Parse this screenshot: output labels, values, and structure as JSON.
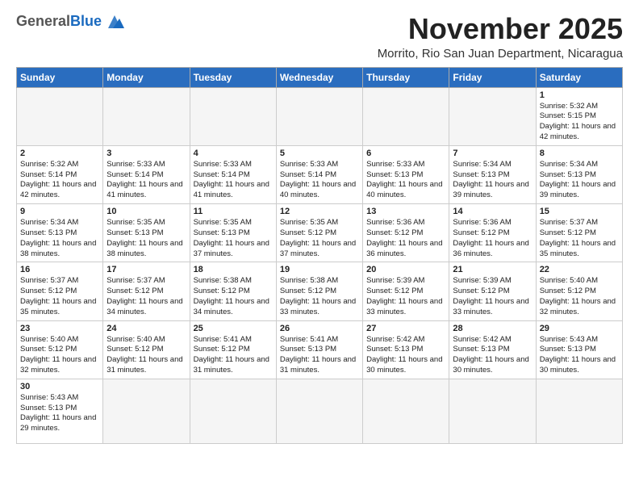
{
  "header": {
    "logo_general": "General",
    "logo_blue": "Blue",
    "month_title": "November 2025",
    "subtitle": "Morrito, Rio San Juan Department, Nicaragua"
  },
  "weekdays": [
    "Sunday",
    "Monday",
    "Tuesday",
    "Wednesday",
    "Thursday",
    "Friday",
    "Saturday"
  ],
  "weeks": [
    [
      {
        "day": "",
        "info": ""
      },
      {
        "day": "",
        "info": ""
      },
      {
        "day": "",
        "info": ""
      },
      {
        "day": "",
        "info": ""
      },
      {
        "day": "",
        "info": ""
      },
      {
        "day": "",
        "info": ""
      },
      {
        "day": "1",
        "info": "Sunrise: 5:32 AM\nSunset: 5:15 PM\nDaylight: 11 hours and 42 minutes."
      }
    ],
    [
      {
        "day": "2",
        "info": "Sunrise: 5:32 AM\nSunset: 5:14 PM\nDaylight: 11 hours and 42 minutes."
      },
      {
        "day": "3",
        "info": "Sunrise: 5:33 AM\nSunset: 5:14 PM\nDaylight: 11 hours and 41 minutes."
      },
      {
        "day": "4",
        "info": "Sunrise: 5:33 AM\nSunset: 5:14 PM\nDaylight: 11 hours and 41 minutes."
      },
      {
        "day": "5",
        "info": "Sunrise: 5:33 AM\nSunset: 5:14 PM\nDaylight: 11 hours and 40 minutes."
      },
      {
        "day": "6",
        "info": "Sunrise: 5:33 AM\nSunset: 5:13 PM\nDaylight: 11 hours and 40 minutes."
      },
      {
        "day": "7",
        "info": "Sunrise: 5:34 AM\nSunset: 5:13 PM\nDaylight: 11 hours and 39 minutes."
      },
      {
        "day": "8",
        "info": "Sunrise: 5:34 AM\nSunset: 5:13 PM\nDaylight: 11 hours and 39 minutes."
      }
    ],
    [
      {
        "day": "9",
        "info": "Sunrise: 5:34 AM\nSunset: 5:13 PM\nDaylight: 11 hours and 38 minutes."
      },
      {
        "day": "10",
        "info": "Sunrise: 5:35 AM\nSunset: 5:13 PM\nDaylight: 11 hours and 38 minutes."
      },
      {
        "day": "11",
        "info": "Sunrise: 5:35 AM\nSunset: 5:13 PM\nDaylight: 11 hours and 37 minutes."
      },
      {
        "day": "12",
        "info": "Sunrise: 5:35 AM\nSunset: 5:12 PM\nDaylight: 11 hours and 37 minutes."
      },
      {
        "day": "13",
        "info": "Sunrise: 5:36 AM\nSunset: 5:12 PM\nDaylight: 11 hours and 36 minutes."
      },
      {
        "day": "14",
        "info": "Sunrise: 5:36 AM\nSunset: 5:12 PM\nDaylight: 11 hours and 36 minutes."
      },
      {
        "day": "15",
        "info": "Sunrise: 5:37 AM\nSunset: 5:12 PM\nDaylight: 11 hours and 35 minutes."
      }
    ],
    [
      {
        "day": "16",
        "info": "Sunrise: 5:37 AM\nSunset: 5:12 PM\nDaylight: 11 hours and 35 minutes."
      },
      {
        "day": "17",
        "info": "Sunrise: 5:37 AM\nSunset: 5:12 PM\nDaylight: 11 hours and 34 minutes."
      },
      {
        "day": "18",
        "info": "Sunrise: 5:38 AM\nSunset: 5:12 PM\nDaylight: 11 hours and 34 minutes."
      },
      {
        "day": "19",
        "info": "Sunrise: 5:38 AM\nSunset: 5:12 PM\nDaylight: 11 hours and 33 minutes."
      },
      {
        "day": "20",
        "info": "Sunrise: 5:39 AM\nSunset: 5:12 PM\nDaylight: 11 hours and 33 minutes."
      },
      {
        "day": "21",
        "info": "Sunrise: 5:39 AM\nSunset: 5:12 PM\nDaylight: 11 hours and 33 minutes."
      },
      {
        "day": "22",
        "info": "Sunrise: 5:40 AM\nSunset: 5:12 PM\nDaylight: 11 hours and 32 minutes."
      }
    ],
    [
      {
        "day": "23",
        "info": "Sunrise: 5:40 AM\nSunset: 5:12 PM\nDaylight: 11 hours and 32 minutes."
      },
      {
        "day": "24",
        "info": "Sunrise: 5:40 AM\nSunset: 5:12 PM\nDaylight: 11 hours and 31 minutes."
      },
      {
        "day": "25",
        "info": "Sunrise: 5:41 AM\nSunset: 5:12 PM\nDaylight: 11 hours and 31 minutes."
      },
      {
        "day": "26",
        "info": "Sunrise: 5:41 AM\nSunset: 5:13 PM\nDaylight: 11 hours and 31 minutes."
      },
      {
        "day": "27",
        "info": "Sunrise: 5:42 AM\nSunset: 5:13 PM\nDaylight: 11 hours and 30 minutes."
      },
      {
        "day": "28",
        "info": "Sunrise: 5:42 AM\nSunset: 5:13 PM\nDaylight: 11 hours and 30 minutes."
      },
      {
        "day": "29",
        "info": "Sunrise: 5:43 AM\nSunset: 5:13 PM\nDaylight: 11 hours and 30 minutes."
      }
    ],
    [
      {
        "day": "30",
        "info": "Sunrise: 5:43 AM\nSunset: 5:13 PM\nDaylight: 11 hours and 29 minutes."
      },
      {
        "day": "",
        "info": ""
      },
      {
        "day": "",
        "info": ""
      },
      {
        "day": "",
        "info": ""
      },
      {
        "day": "",
        "info": ""
      },
      {
        "day": "",
        "info": ""
      },
      {
        "day": "",
        "info": ""
      }
    ]
  ]
}
